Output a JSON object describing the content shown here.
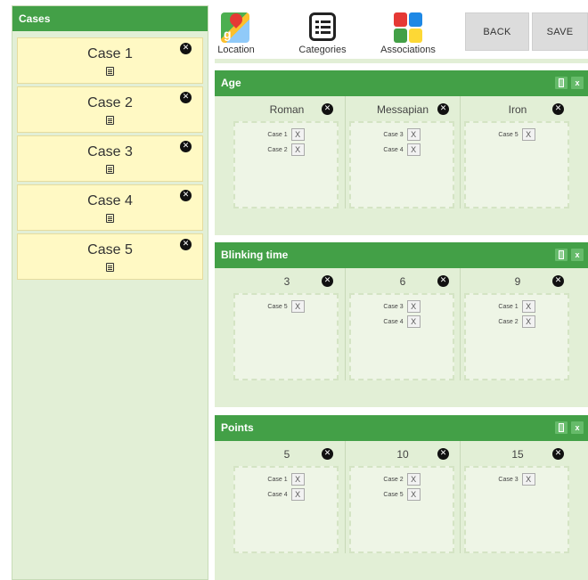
{
  "sidebar": {
    "title": "Cases",
    "cases": [
      {
        "label": "Case 1"
      },
      {
        "label": "Case 2"
      },
      {
        "label": "Case 3"
      },
      {
        "label": "Case 4"
      },
      {
        "label": "Case 5"
      }
    ],
    "remove_glyph": "✕"
  },
  "toolbar": {
    "location_label": "Location",
    "categories_label": "Categories",
    "associations_label": "Associations",
    "back_label": "BACK",
    "save_label": "SAVE"
  },
  "colors": {
    "header_green": "#43a047",
    "panel_bg": "#e2efd6",
    "case_card": "#fff9c4"
  },
  "panels": [
    {
      "title": "Age",
      "columns": [
        {
          "title": "Roman",
          "items": [
            "Case 1",
            "Case 2"
          ]
        },
        {
          "title": "Messapian",
          "items": [
            "Case 3",
            "Case 4"
          ]
        },
        {
          "title": "Iron",
          "items": [
            "Case 5"
          ]
        }
      ]
    },
    {
      "title": "Blinking time",
      "columns": [
        {
          "title": "3",
          "items": [
            "Case 5"
          ]
        },
        {
          "title": "6",
          "items": [
            "Case 3",
            "Case 4"
          ]
        },
        {
          "title": "9",
          "items": [
            "Case 1",
            "Case 2"
          ]
        }
      ]
    },
    {
      "title": "Points",
      "columns": [
        {
          "title": "5",
          "items": [
            "Case 1",
            "Case 4"
          ]
        },
        {
          "title": "10",
          "items": [
            "Case 2",
            "Case 5"
          ]
        },
        {
          "title": "15",
          "items": [
            "Case 3"
          ]
        }
      ]
    }
  ],
  "labels": {
    "chip_remove": "X",
    "panel_close": "x"
  }
}
